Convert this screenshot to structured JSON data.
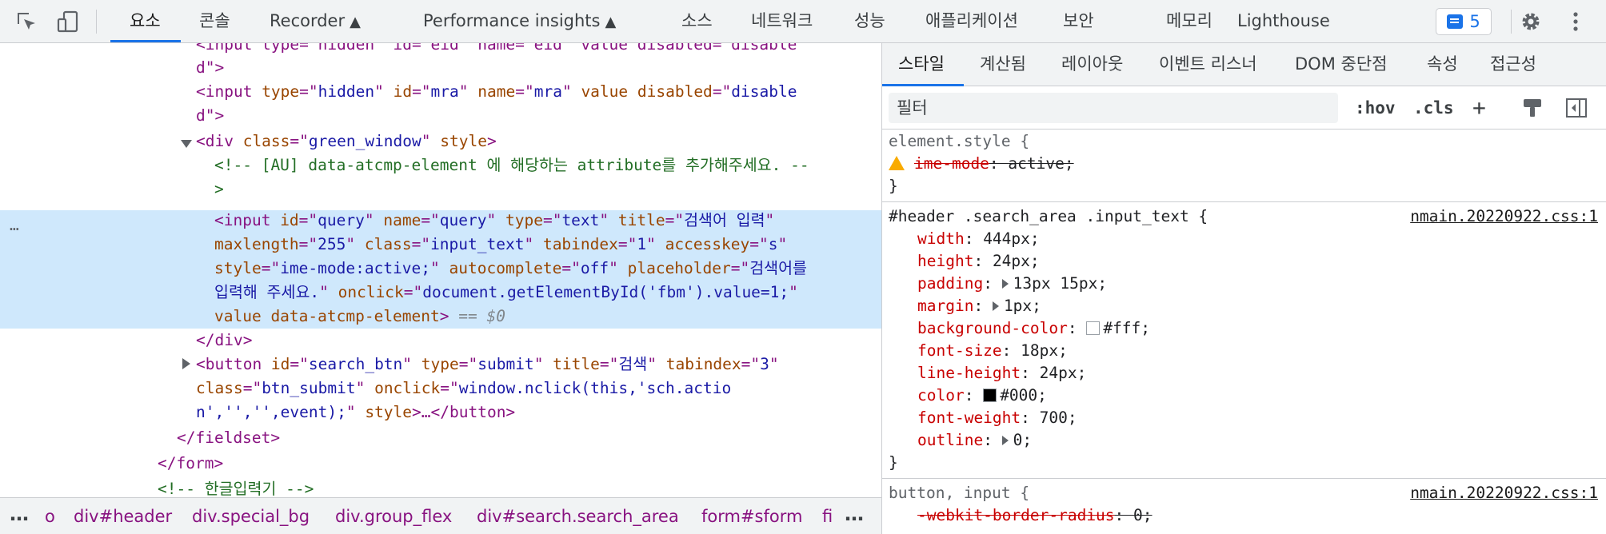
{
  "toolbar": {
    "tabs": [
      {
        "label": "요소",
        "active": true
      },
      {
        "label": "콘솔"
      },
      {
        "label": "Recorder"
      },
      {
        "label": "Performance insights"
      },
      {
        "label": "소스"
      },
      {
        "label": "네트워크"
      },
      {
        "label": "성능"
      },
      {
        "label": "애플리케이션"
      },
      {
        "label": "보안"
      },
      {
        "label": "메모리"
      },
      {
        "label": "Lighthouse"
      }
    ],
    "issues_count": "5",
    "icons": [
      "inspect-element-icon",
      "device-toolbar-icon",
      "flask-icon",
      "issues-icon",
      "settings-gear-icon",
      "more-menu-icon"
    ],
    "accent_color": "#1a73e8"
  },
  "elements": {
    "lines": [
      {
        "t0": "<input type=\"hidden\" id=\"eid\" name=\"eid\" value disabled=\"disable"
      },
      {
        "t0": "d\">"
      },
      {
        "p1": "<input ",
        "a1": "type",
        "e1": "=\"",
        "v1": "hidden",
        "e2": "\" ",
        "a2": "id",
        "e3": "=\"",
        "v2": "mra",
        "e4": "\" ",
        "a3": "name",
        "e5": "=\"",
        "v3": "mra",
        "e6": "\" ",
        "a4": "value disabled",
        "e7": "=\"",
        "v4": "disable"
      },
      {
        "t0": "d\">"
      },
      {
        "p1": "<div ",
        "a1": "class",
        "e1": "=\"",
        "v1": "green_window",
        "e2": "\" ",
        "a2": "style",
        "e3": ">"
      },
      {
        "t0": "<!-- [AU] data-atcmp-element 에 해당하는 attribute를 추가해주세요. --"
      },
      {
        "t0": ">"
      },
      {
        "p1": "<input ",
        "a1": "id",
        "e1": "=\"",
        "v1": "query",
        "e2": "\" ",
        "a2": "name",
        "e3": "=\"",
        "v2": "query",
        "e4": "\" ",
        "a3": "type",
        "e5": "=\"",
        "v3": "text",
        "e6": "\" ",
        "a4": "title",
        "e7": "=\"",
        "v4": "검색어 입력",
        "e8": "\""
      },
      {
        "a1": "maxlength",
        "e1": "=\"",
        "v1": "255",
        "e2": "\" ",
        "a2": "class",
        "e3": "=\"",
        "v2": "input_text",
        "e4": "\" ",
        "a3": "tabindex",
        "e5": "=\"",
        "v3": "1",
        "e6": "\" ",
        "a4": "accesskey",
        "e7": "=\"",
        "v4": "s",
        "e8": "\""
      },
      {
        "a1": "style",
        "e1": "=\"",
        "v1": "ime-mode:active;",
        "e2": "\" ",
        "a2": "autocomplete",
        "e3": "=\"",
        "v2": "off",
        "e4": "\" ",
        "a3": "placeholder",
        "e5": "=\"",
        "v3": "검색어를"
      },
      {
        "v1": "입력해 주세요.",
        "e1": "\" ",
        "a1": "onclick",
        "e2": "=\"",
        "v2": "document.getElementById('fbm').value=1;",
        "e3": "\""
      },
      {
        "a1": "value data-atcmp-element",
        "e1": ">",
        "d1": " == $0"
      },
      {
        "t0": "</div>"
      },
      {
        "p1": "<button ",
        "a1": "id",
        "e1": "=\"",
        "v1": "search_btn",
        "e2": "\" ",
        "a2": "type",
        "e3": "=\"",
        "v2": "submit",
        "e4": "\" ",
        "a3": "title",
        "e5": "=\"",
        "v3": "검색",
        "e6": "\" ",
        "a4": "tabindex",
        "e7": "=\"",
        "v4": "3",
        "e8": "\""
      },
      {
        "a1": "class",
        "e1": "=\"",
        "v1": "btn_submit",
        "e2": "\" ",
        "a2": "onclick",
        "e3": "=\"",
        "v2": "window.nclick(this,'sch.actio"
      },
      {
        "v1": "n','','',event);",
        "e1": "\" ",
        "a1": "style",
        "e2": ">…</button>"
      },
      {
        "t0": "</fieldset>"
      },
      {
        "t0": "</form>"
      },
      {
        "t0": "<!-- 한글입력기 -->"
      }
    ],
    "gutter_dots": "…",
    "breadcrumb": [
      {
        "label": "…"
      },
      {
        "label": "o"
      },
      {
        "label": "div#header"
      },
      {
        "label": "div.special_bg"
      },
      {
        "label": "div.group_flex"
      },
      {
        "label": "div#search.search_area"
      },
      {
        "label": "form#sform"
      },
      {
        "label": "fi"
      },
      {
        "label": "…"
      }
    ]
  },
  "styles_pane": {
    "tabs": [
      {
        "label": "스타일",
        "active": true
      },
      {
        "label": "계산됨"
      },
      {
        "label": "레이아웃"
      },
      {
        "label": "이벤트 리스너"
      },
      {
        "label": "DOM 중단점"
      },
      {
        "label": "속성"
      },
      {
        "label": "접근성"
      }
    ],
    "filter_placeholder": "필터",
    "hov_label": ":hov",
    "cls_label": ".cls",
    "plus_label": "+",
    "rules": [
      {
        "selector": "element.style {",
        "props": [
          {
            "name": "ime-mode",
            "value": "active;",
            "struck": true,
            "warn": true
          }
        ],
        "close": "}"
      },
      {
        "selector": "#header .search_area .input_text {",
        "source": "nmain.20220922.css:1",
        "props": [
          {
            "name": "width",
            "value": "444px;"
          },
          {
            "name": "height",
            "value": "24px;"
          },
          {
            "name": "padding",
            "value": "13px 15px;",
            "expand": true
          },
          {
            "name": "margin",
            "value": "1px;",
            "expand": true
          },
          {
            "name": "background-color",
            "value": "#fff;",
            "swatch": "#ffffff"
          },
          {
            "name": "font-size",
            "value": "18px;"
          },
          {
            "name": "line-height",
            "value": "24px;"
          },
          {
            "name": "color",
            "value": "#000;",
            "swatch": "#000000"
          },
          {
            "name": "font-weight",
            "value": "700;"
          },
          {
            "name": "outline",
            "value": "0;",
            "expand": true
          }
        ],
        "close": "}"
      },
      {
        "selector": "button, input {",
        "source": "nmain.20220922.css:1",
        "props": [
          {
            "name": "-webkit-border-radius",
            "value": "0;",
            "struck": true
          }
        ]
      }
    ]
  }
}
